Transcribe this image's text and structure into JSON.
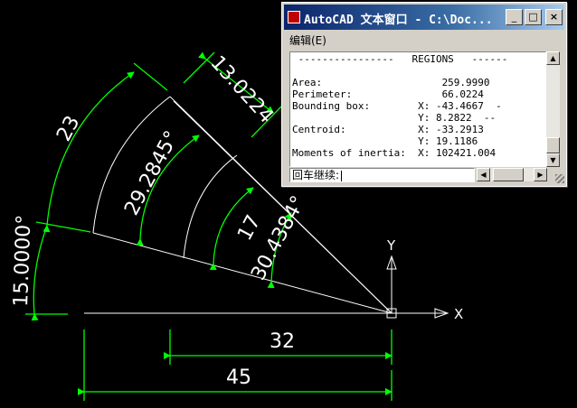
{
  "drawing": {
    "dims": {
      "length_23": "23",
      "angle_15": "15.0000°",
      "length_13": "13.0224",
      "angle_29": "29.2845°",
      "length_17": "17",
      "angle_30": "30.4384°",
      "length_32": "32",
      "length_45": "45"
    },
    "ucs": {
      "x_label": "X",
      "y_label": "Y"
    },
    "colors": {
      "geometry": "#ffffff",
      "dimensions": "#00ff00",
      "background": "#000000"
    }
  },
  "text_window": {
    "title": "AutoCAD 文本窗口 - C:\\Doc...",
    "menu": "编辑(E)",
    "title_buttons": {
      "minimize": "_",
      "maximize": "□",
      "close": "×"
    },
    "lines": [
      " ----------------   REGIONS   ------",
      "",
      "Area:                    259.9990",
      "Perimeter:               66.0224",
      "Bounding box:        X: -43.4667  -",
      "                     Y: 8.2822  --",
      "Centroid:            X: -33.2913",
      "                     Y: 19.1186",
      "Moments of inertia:  X: 102421.004"
    ],
    "prompt": "回车继续:"
  }
}
